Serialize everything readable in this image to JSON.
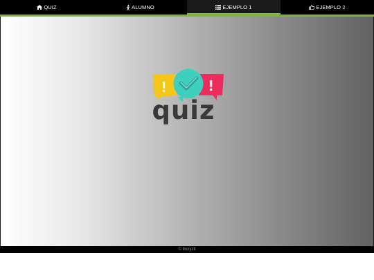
{
  "nav": {
    "items": [
      {
        "label": "QUIZ",
        "icon": "home-icon",
        "active": false
      },
      {
        "label": "ALUMNO",
        "icon": "walking-person-icon",
        "active": false
      },
      {
        "label": "EJEMPLO 1",
        "icon": "list-icon",
        "active": true
      },
      {
        "label": "EJEMPLO 2",
        "icon": "thumbs-up-icon",
        "active": false
      }
    ]
  },
  "logo": {
    "text": "quiz",
    "icon": "quiz-speech-bubbles-logo",
    "colors": {
      "yellow": "#f5c518",
      "teal": "#3ecfbf",
      "red": "#ee2c5c",
      "text": "#3a3a3a"
    }
  },
  "footer": {
    "text": "© Ibcryztl"
  },
  "colors": {
    "accent": "#7cb82f",
    "navbar": "#000000"
  }
}
